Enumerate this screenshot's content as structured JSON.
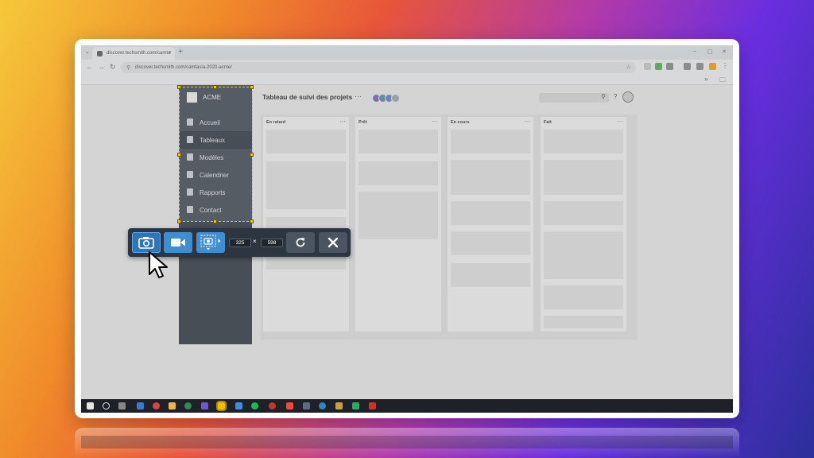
{
  "browser": {
    "tab_title": "discover.techsmith.com/camta",
    "url": "discover.techsmith.com/camtasia-2020-acme/",
    "new_tab": "+",
    "tab_close": "×",
    "tab_list": "⌄",
    "window_controls": [
      "–",
      "▢",
      "✕"
    ],
    "nav": [
      "←",
      "→",
      "↻"
    ],
    "bookmarks_more": "»",
    "bookmarks_folder": "🗀"
  },
  "app": {
    "brand": "ACME",
    "sidebar": [
      {
        "label": "Accueil",
        "icon": "home-icon",
        "active": false
      },
      {
        "label": "Tableaux",
        "icon": "clipboard-icon",
        "active": true
      },
      {
        "label": "Modèles",
        "icon": "template-icon",
        "active": false
      },
      {
        "label": "Calendrier",
        "icon": "calendar-icon",
        "active": false
      },
      {
        "label": "Rapports",
        "icon": "report-icon",
        "active": false
      },
      {
        "label": "Contact",
        "icon": "people-icon",
        "active": false
      }
    ],
    "board_title": "Tableau de suivi des projets",
    "more": "···",
    "help": "?",
    "columns": [
      {
        "title": "En retard"
      },
      {
        "title": "Prêt"
      },
      {
        "title": "En cours"
      },
      {
        "title": "Fait"
      }
    ]
  },
  "capture_toolbar": {
    "width_value": "325",
    "height_value": "598",
    "times": "×"
  },
  "colors": {
    "selection": "#f5c400",
    "capture_blue": "#3d8fd1",
    "sidebar_bg": "#2a323c"
  }
}
